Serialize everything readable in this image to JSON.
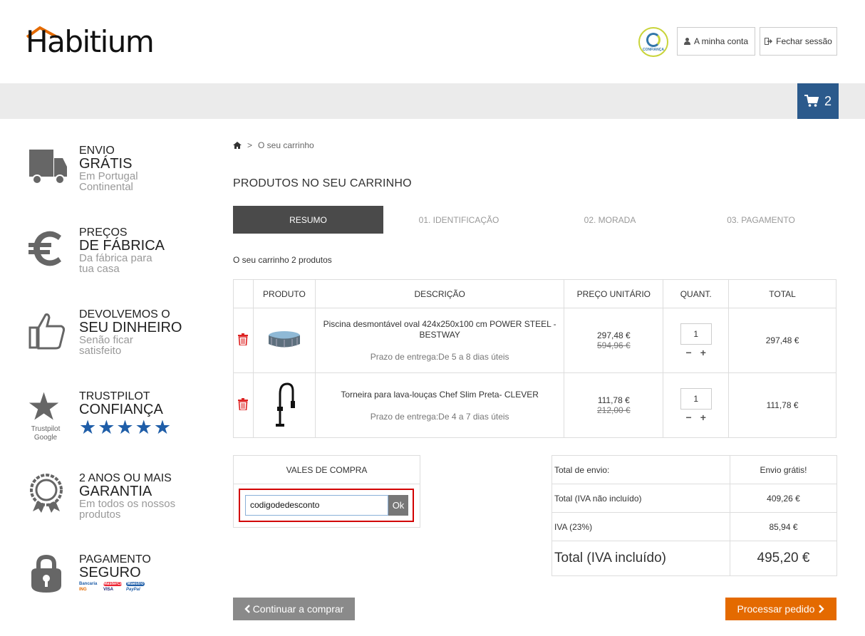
{
  "header": {
    "logo_text": "Habitium",
    "trust_badge_text": "CONFIANÇA",
    "account_label": "A minha conta",
    "logout_label": "Fechar sessão",
    "cart_count": "2",
    "brand_color": "#e46a00",
    "cart_color": "#2b5a8c"
  },
  "sidebar": {
    "features": [
      {
        "icon": "truck-icon",
        "title1": "Envio",
        "title2": "Grátis",
        "sub1": "Em Portugal",
        "sub2": "Continental"
      },
      {
        "icon": "euro-icon",
        "title1": "Preços",
        "title2": "de Fábrica",
        "sub1": "Da fábrica para",
        "sub2": "tua casa"
      },
      {
        "icon": "thumbs-up-icon",
        "title1": "Devolvemos o",
        "title2": "seu dinheiro",
        "sub1": "Senão ficar",
        "sub2": "satisfeito"
      },
      {
        "icon": "star-icon",
        "title1": "Trustpilot",
        "title2": "Confiança",
        "badge1": "Trustpilot",
        "badge2": "Google",
        "stars": "★★★★★"
      },
      {
        "icon": "award-icon",
        "title1": "2 anos ou mais",
        "title2": "garantia",
        "sub1": "Em todos os nossos",
        "sub2": "produtos"
      },
      {
        "icon": "lock-icon",
        "title1": "Pagamento",
        "title2": "seguro",
        "payments": [
          "Bancaria",
          "MasterCard",
          "Maestro",
          "ING",
          "VISA",
          "PayPal"
        ]
      }
    ]
  },
  "breadcrumb": {
    "current": "O seu carrinho"
  },
  "page_title": "PRODUTOS NO SEU CARRINHO",
  "steps": [
    "RESUMO",
    "01. IDENTIFICAÇÃO",
    "02. MORADA",
    "03. PAGAMENTO"
  ],
  "cart_summary": "O seu carrinho 2 produtos",
  "table": {
    "headers": [
      "PRODUTO",
      "DESCRIÇÃO",
      "PREÇO UNITÁRIO",
      "QUANT.",
      "TOTAL"
    ],
    "rows": [
      {
        "name": "Piscina desmontável oval 424x250x100 cm POWER STEEL - BESTWAY",
        "delivery": "Prazo de entrega:De 5 a 8 dias úteis",
        "price": "297,48 €",
        "old_price": "594,96 €",
        "qty": "1",
        "total": "297,48 €"
      },
      {
        "name": "Torneira para lava-louças Chef Slim Preta- CLEVER",
        "delivery": "Prazo de entrega:De 4 a 7 dias úteis",
        "price": "111,78 €",
        "old_price": "212,00 €",
        "qty": "1",
        "total": "111,78 €"
      }
    ]
  },
  "vouchers": {
    "title": "VALES DE COMPRA",
    "code": "codigodedesconto",
    "ok_label": "Ok"
  },
  "totals": {
    "shipping_label": "Total de envio:",
    "shipping_value": "Envio grátis!",
    "net_label": "Total (IVA não incluído)",
    "net_value": "409,26 €",
    "vat_label": "IVA (23%)",
    "vat_value": "85,94 €",
    "grand_label": "Total (IVA incluído)",
    "grand_value": "495,20 €"
  },
  "actions": {
    "continue_label": "Continuar a comprar",
    "process_label": "Processar pedido"
  }
}
